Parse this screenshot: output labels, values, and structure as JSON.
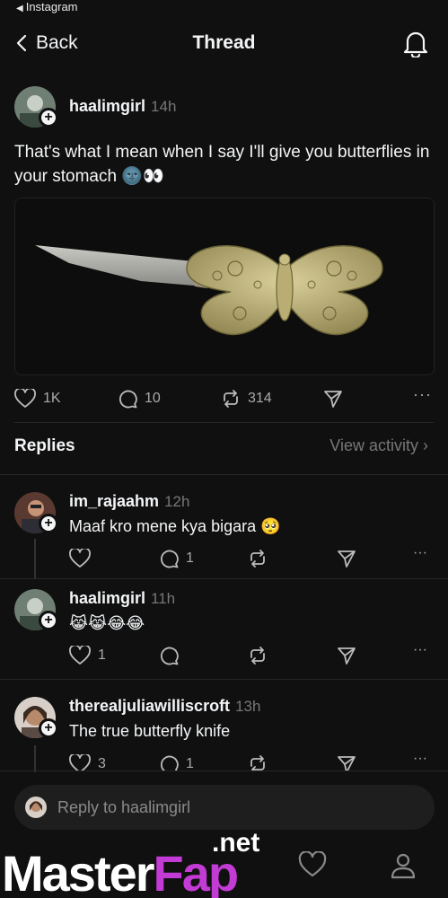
{
  "status_bar": {
    "back_app": "Instagram"
  },
  "nav": {
    "back_label": "Back",
    "title": "Thread"
  },
  "post": {
    "username": "haalimgirl",
    "time": "14h",
    "text": "That's what I mean when I say I'll give you butterflies in your stomach 🌚👀",
    "likes": "1K",
    "comments": "10",
    "reposts": "314"
  },
  "replies_section": {
    "label": "Replies",
    "view_activity": "View activity"
  },
  "replies": [
    {
      "username": "im_rajaahm",
      "time": "12h",
      "text": "Maaf kro mene kya bigara 🥺",
      "likes": "",
      "comments": "1"
    },
    {
      "username": "haalimgirl",
      "time": "11h",
      "text": "😹😹😂😂",
      "likes": "1",
      "comments": ""
    },
    {
      "username": "therealjuliawilliscroft",
      "time": "13h",
      "text": "The true butterfly knife",
      "likes": "3",
      "comments": "1"
    }
  ],
  "reply_input": {
    "placeholder": "Reply to haalimgirl"
  },
  "watermark": {
    "master": "Master",
    "fap": "Fap",
    "net": ".net"
  },
  "colors": {
    "background": "#101010",
    "text": "#f3f5f7",
    "muted": "#777777",
    "watermark_accent": "#c23bd4"
  }
}
